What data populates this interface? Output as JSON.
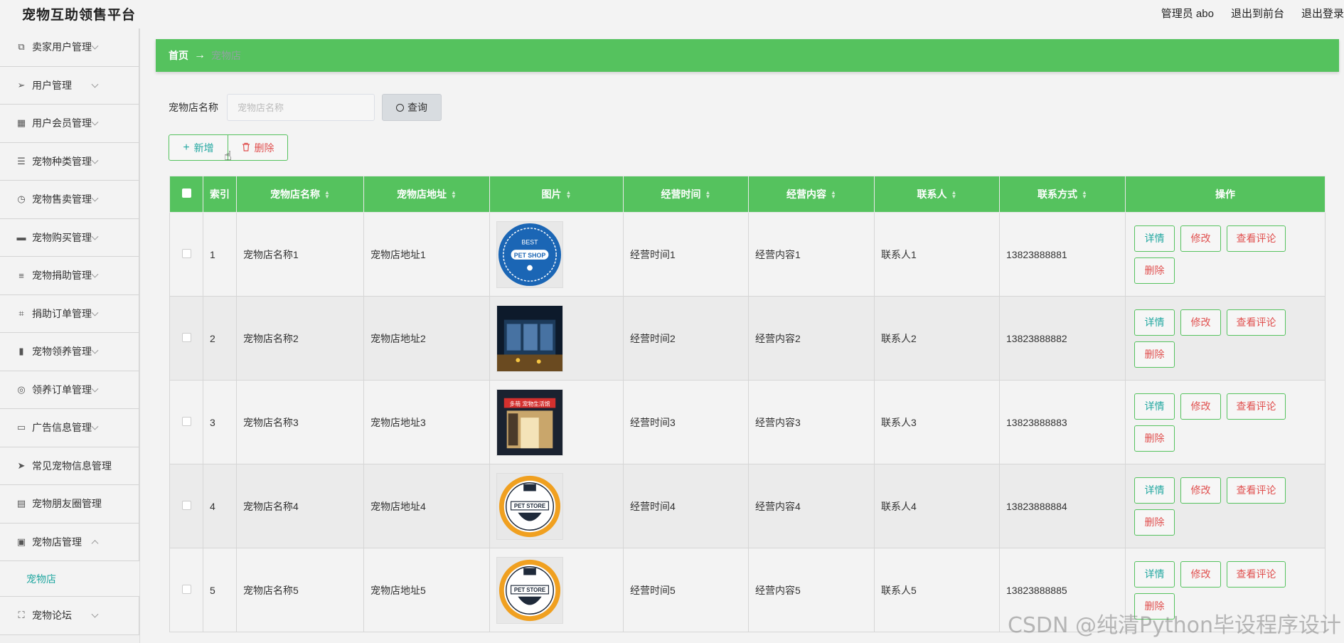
{
  "app": {
    "title": "宠物互助领售平台"
  },
  "topnav": {
    "admin": "管理员 abo",
    "front": "退出到前台",
    "logout": "退出登录"
  },
  "sidebar": {
    "items": [
      {
        "label": "卖家用户管理",
        "icon": "copy-icon"
      },
      {
        "label": "用户管理",
        "icon": "send-icon"
      },
      {
        "label": "用户会员管理",
        "icon": "grid-icon"
      },
      {
        "label": "宠物种类管理",
        "icon": "sliders-icon"
      },
      {
        "label": "宠物售卖管理",
        "icon": "clock-icon"
      },
      {
        "label": "宠物购买管理",
        "icon": "chat-icon"
      },
      {
        "label": "宠物捐助管理",
        "icon": "list-icon"
      },
      {
        "label": "捐助订单管理",
        "icon": "crop-icon"
      },
      {
        "label": "宠物领养管理",
        "icon": "bar-chart-icon"
      },
      {
        "label": "领养订单管理",
        "icon": "compass-icon"
      },
      {
        "label": "广告信息管理",
        "icon": "message-icon"
      },
      {
        "label": "常见宠物信息管理",
        "icon": "paper-plane-icon"
      },
      {
        "label": "宠物朋友圈管理",
        "icon": "card-icon"
      },
      {
        "label": "宠物店管理",
        "icon": "clipboard-icon"
      }
    ],
    "sub": "宠物店",
    "after": {
      "label": "宠物论坛",
      "icon": "fullscreen-icon"
    }
  },
  "breadcrumb": {
    "home": "首页",
    "current": "宠物店"
  },
  "search": {
    "label": "宠物店名称",
    "placeholder": "宠物店名称",
    "button": "查询"
  },
  "actions": {
    "add": "新增",
    "delete": "删除"
  },
  "table": {
    "headers": {
      "index": "索引",
      "name": "宠物店名称",
      "address": "宠物店地址",
      "image": "图片",
      "time": "经营时间",
      "content": "经营内容",
      "contact": "联系人",
      "phone": "联系方式",
      "ops": "操作"
    },
    "rows": [
      {
        "index": "1",
        "name": "宠物店名称1",
        "address": "宠物店地址1",
        "image": "best-pet-shop",
        "time": "经营时间1",
        "content": "经营内容1",
        "contact": "联系人1",
        "phone": "13823888881"
      },
      {
        "index": "2",
        "name": "宠物店名称2",
        "address": "宠物店地址2",
        "image": "night-store",
        "time": "经营时间2",
        "content": "经营内容2",
        "contact": "联系人2",
        "phone": "13823888882"
      },
      {
        "index": "3",
        "name": "宠物店名称3",
        "address": "宠物店地址3",
        "image": "storefront",
        "time": "经营时间3",
        "content": "经营内容3",
        "contact": "联系人3",
        "phone": "13823888883"
      },
      {
        "index": "4",
        "name": "宠物店名称4",
        "address": "宠物店地址4",
        "image": "pet-store-badge",
        "time": "经营时间4",
        "content": "经营内容4",
        "contact": "联系人4",
        "phone": "13823888884"
      },
      {
        "index": "5",
        "name": "宠物店名称5",
        "address": "宠物店地址5",
        "image": "pet-store-badge",
        "time": "经营时间5",
        "content": "经营内容5",
        "contact": "联系人5",
        "phone": "13823888885"
      }
    ],
    "ops": {
      "detail": "详情",
      "edit": "修改",
      "review": "查看评论",
      "delete": "删除"
    }
  },
  "watermark": "CSDN @纯清Python毕设程序设计",
  "colors": {
    "accent": "#55c25e",
    "teal": "#22a7a0",
    "danger": "#e0504f"
  }
}
